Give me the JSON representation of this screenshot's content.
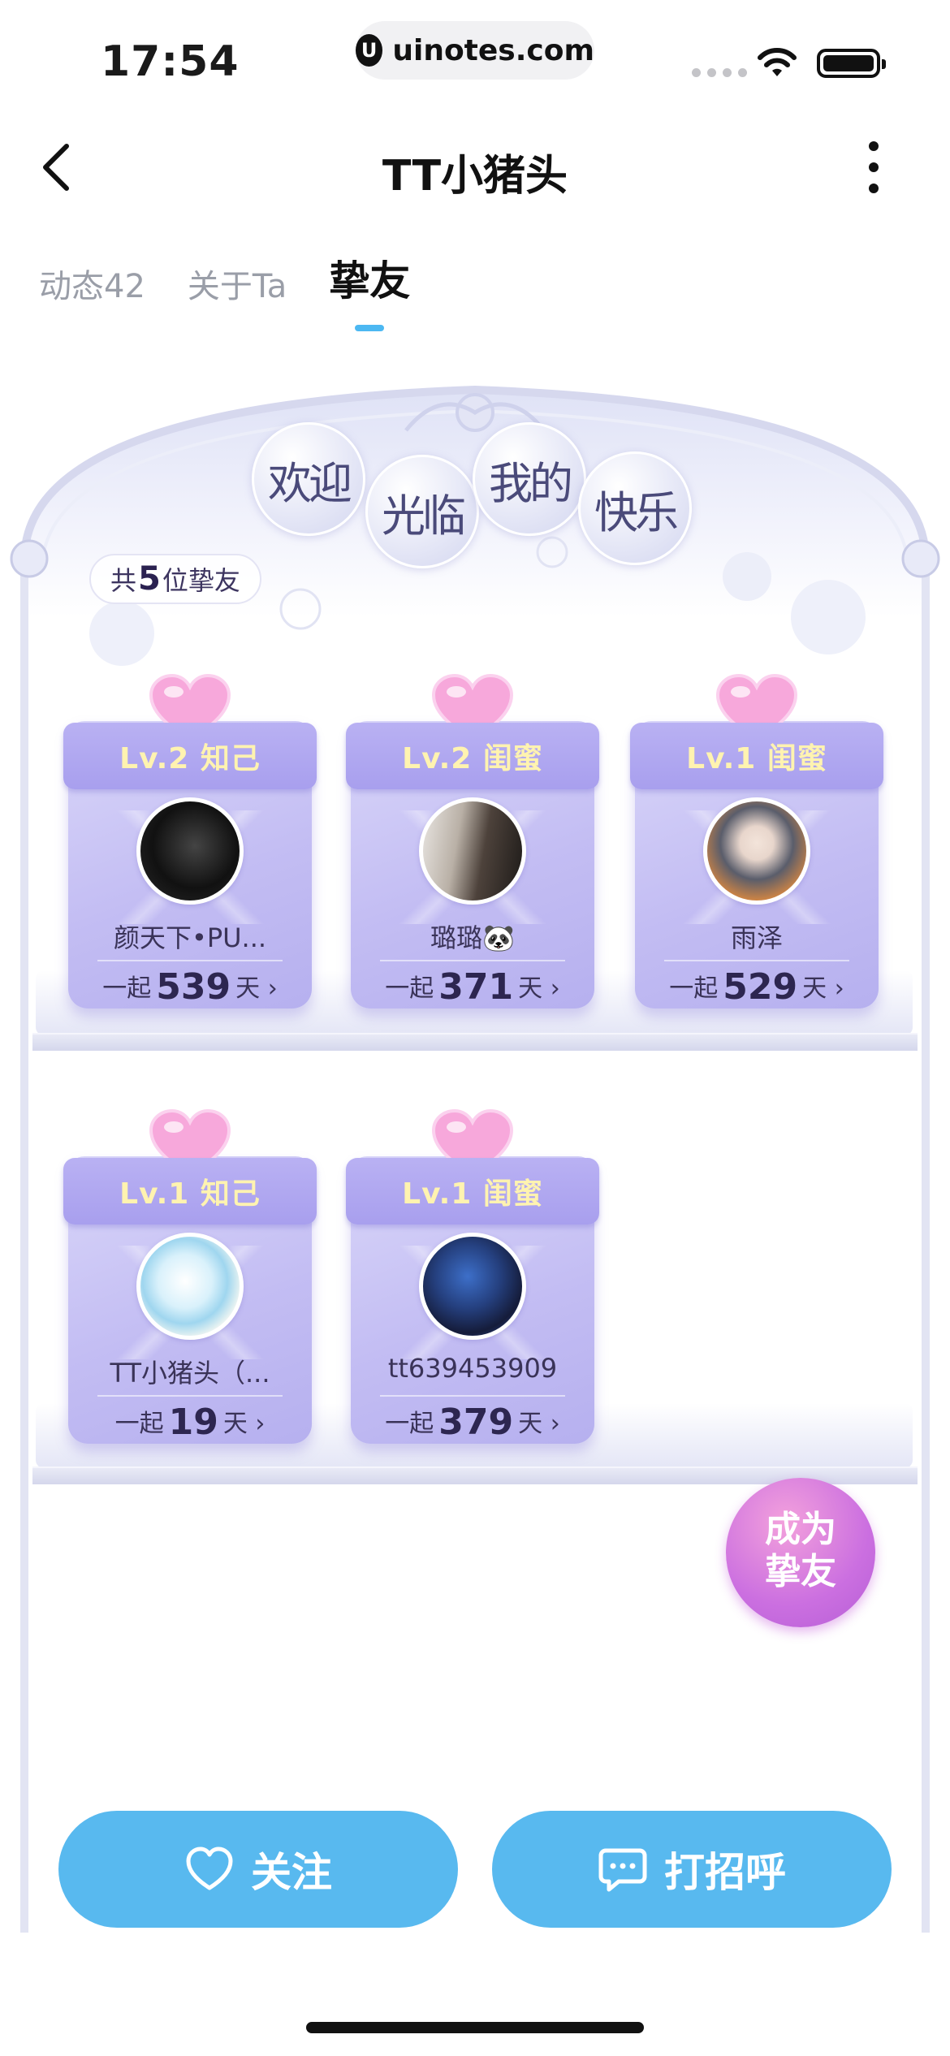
{
  "status_bar": {
    "time": "17:54",
    "url": "uinotes.com"
  },
  "nav": {
    "title": "TT小猪头"
  },
  "tabs": [
    {
      "label": "动态42",
      "active": false
    },
    {
      "label": "关于Ta",
      "active": false
    },
    {
      "label": "挚友",
      "active": true
    }
  ],
  "welcome": [
    "欢迎",
    "光临",
    "我的",
    "快乐"
  ],
  "friend_count": {
    "prefix": "共",
    "count": "5",
    "suffix": "位挚友"
  },
  "friends": [
    {
      "level": "Lv.2 知己",
      "name": "颜天下•PU...",
      "prefix": "一起",
      "days": "539",
      "suffix": "天 ›"
    },
    {
      "level": "Lv.2 闺蜜",
      "name": "璐璐🐼",
      "prefix": "一起",
      "days": "371",
      "suffix": "天 ›"
    },
    {
      "level": "Lv.1 闺蜜",
      "name": "雨泽",
      "prefix": "一起",
      "days": "529",
      "suffix": "天 ›"
    },
    {
      "level": "Lv.1 知己",
      "name": "TT小猪头（...",
      "prefix": "一起",
      "days": "19",
      "suffix": "天 ›"
    },
    {
      "level": "Lv.1 闺蜜",
      "name": "tt639453909",
      "prefix": "一起",
      "days": "379",
      "suffix": "天 ›"
    }
  ],
  "become_friend": {
    "line1": "成为",
    "line2": "挚友"
  },
  "actions": {
    "follow": "关注",
    "greet": "打招呼"
  },
  "colors": {
    "accent": "#58b9ef",
    "card": "#c3bdf3",
    "level_text": "#fff3b0",
    "become": "#cb6fe0"
  }
}
